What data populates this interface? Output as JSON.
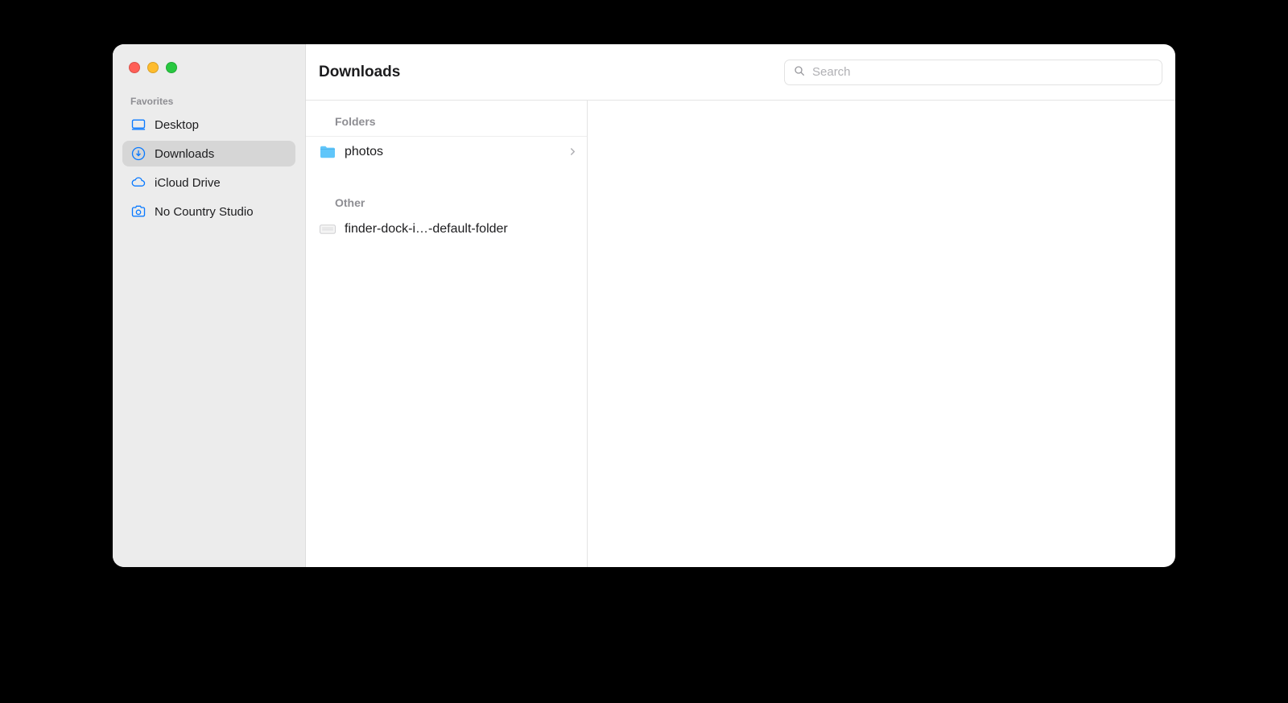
{
  "window": {
    "title": "Downloads"
  },
  "sidebar": {
    "section_label": "Favorites",
    "items": [
      {
        "icon": "desktop-icon",
        "label": "Desktop",
        "selected": false
      },
      {
        "icon": "download-icon",
        "label": "Downloads",
        "selected": true
      },
      {
        "icon": "cloud-icon",
        "label": "iCloud Drive",
        "selected": false
      },
      {
        "icon": "camera-folder-icon",
        "label": "No Country Studio",
        "selected": false
      }
    ]
  },
  "search": {
    "placeholder": "Search"
  },
  "column": {
    "groups": [
      {
        "label": "Folders",
        "items": [
          {
            "kind": "folder",
            "name": "photos",
            "has_children": true
          }
        ]
      },
      {
        "label": "Other",
        "items": [
          {
            "kind": "file",
            "name": "finder-dock-i…-default-folder",
            "has_children": false
          }
        ]
      }
    ]
  }
}
